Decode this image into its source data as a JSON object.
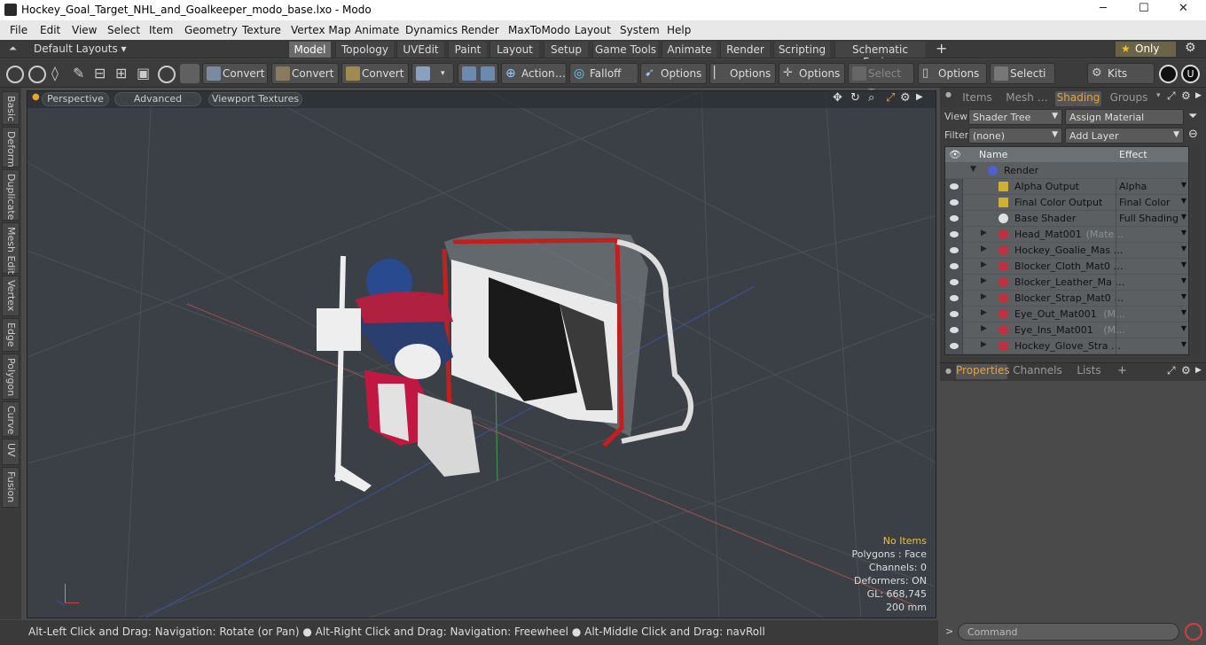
{
  "window": {
    "title": "Hockey_Goal_Target_NHL_and_Goalkeeper_modo_base.lxo - Modo",
    "controls": [
      "─",
      "☐",
      "✕"
    ]
  },
  "menu": [
    "File",
    "Edit",
    "View",
    "Select",
    "Item",
    "Geometry",
    "Texture",
    "Vertex Map",
    "Animate",
    "Dynamics",
    "Render",
    "MaxToModo",
    "Layout",
    "System",
    "Help"
  ],
  "layouts": {
    "label": "Default Layouts ▾"
  },
  "tabs": [
    "Model",
    "Topology",
    "UVEdit",
    "Paint",
    "Layout",
    "Setup",
    "Game Tools",
    "Animate",
    "Render",
    "Scripting",
    "Schematic Fusion"
  ],
  "tabs_active": "Model",
  "tabs_add": "+",
  "only": {
    "star": "★",
    "label": "Only"
  },
  "toolbar": {
    "convert1": "Convert",
    "convert2": "Convert",
    "convert3": "Convert",
    "action": "Action",
    "action_more": "…",
    "falloff": "Falloff",
    "options1": "Options",
    "options2": "Options",
    "options3": "Options",
    "options4": "Options",
    "select_t": "Select T…",
    "selecti": "Selecti …",
    "kits": "Kits"
  },
  "left_tabs": [
    "Basic",
    "Deform",
    "Duplicate",
    "Mesh Edit",
    "Vertex",
    "Edge",
    "Polygon",
    "Curve",
    "UV",
    "Fusion"
  ],
  "viewport": {
    "perspective": "Perspective",
    "advanced": "Advanced",
    "textures": "Viewport Textures",
    "info": {
      "no_items": "No Items",
      "polygons": "Polygons : Face",
      "channels": "Channels: 0",
      "deformers": "Deformers: ON",
      "gl": "GL: 668,745",
      "scale": "200 mm"
    }
  },
  "status": {
    "text": "Alt-Left Click and Drag: Navigation: Rotate (or Pan) ● Alt-Right Click and Drag: Navigation: Freewheel ● Alt-Middle Click and Drag: navRoll"
  },
  "right": {
    "tabs": [
      "Items",
      "Mesh …",
      "Shading",
      "Groups"
    ],
    "active_tab": "Shading",
    "view_label": "View",
    "view_value": "Shader Tree",
    "assign": "Assign Material",
    "filter_label": "Filter",
    "filter_value": "(none)",
    "add_layer": "Add Layer",
    "col_name": "Name",
    "col_effect": "Effect",
    "rows": [
      {
        "name": "Render",
        "effect": "",
        "icon": "render",
        "indent": 0
      },
      {
        "name": "Alpha Output",
        "effect": "Alpha",
        "icon": "output",
        "indent": 1
      },
      {
        "name": "Final Color Output",
        "effect": "Final Color",
        "icon": "output",
        "indent": 1
      },
      {
        "name": "Base Shader",
        "effect": "Full Shading",
        "icon": "shader",
        "indent": 1
      },
      {
        "name": "Head_Mat001",
        "suffix": "(Mate…",
        "effect": "",
        "icon": "material",
        "indent": 1
      },
      {
        "name": "Hockey_Goalie_Mas …",
        "suffix": "",
        "effect": "",
        "icon": "material",
        "indent": 1
      },
      {
        "name": "Blocker_Cloth_Mat0 …",
        "suffix": "",
        "effect": "",
        "icon": "material",
        "indent": 1
      },
      {
        "name": "Blocker_Leather_Ma …",
        "suffix": "",
        "effect": "",
        "icon": "material",
        "indent": 1
      },
      {
        "name": "Blocker_Strap_Mat0 …",
        "suffix": "",
        "effect": "",
        "icon": "material",
        "indent": 1
      },
      {
        "name": "Eye_Out_Mat001",
        "suffix": "(M…",
        "effect": "",
        "icon": "material",
        "indent": 1
      },
      {
        "name": "Eye_Ins_Mat001",
        "suffix": "(M…",
        "effect": "",
        "icon": "material",
        "indent": 1
      },
      {
        "name": "Hockey_Glove_Stra …",
        "suffix": "",
        "effect": "",
        "icon": "material",
        "indent": 1
      }
    ],
    "lower_tabs": [
      "Properties",
      "Channels",
      "Lists"
    ],
    "lower_active": "Properties",
    "command_placeholder": "Command"
  },
  "colors": {
    "accent": "#f0a030",
    "viewport_bg": "#3a4045"
  }
}
